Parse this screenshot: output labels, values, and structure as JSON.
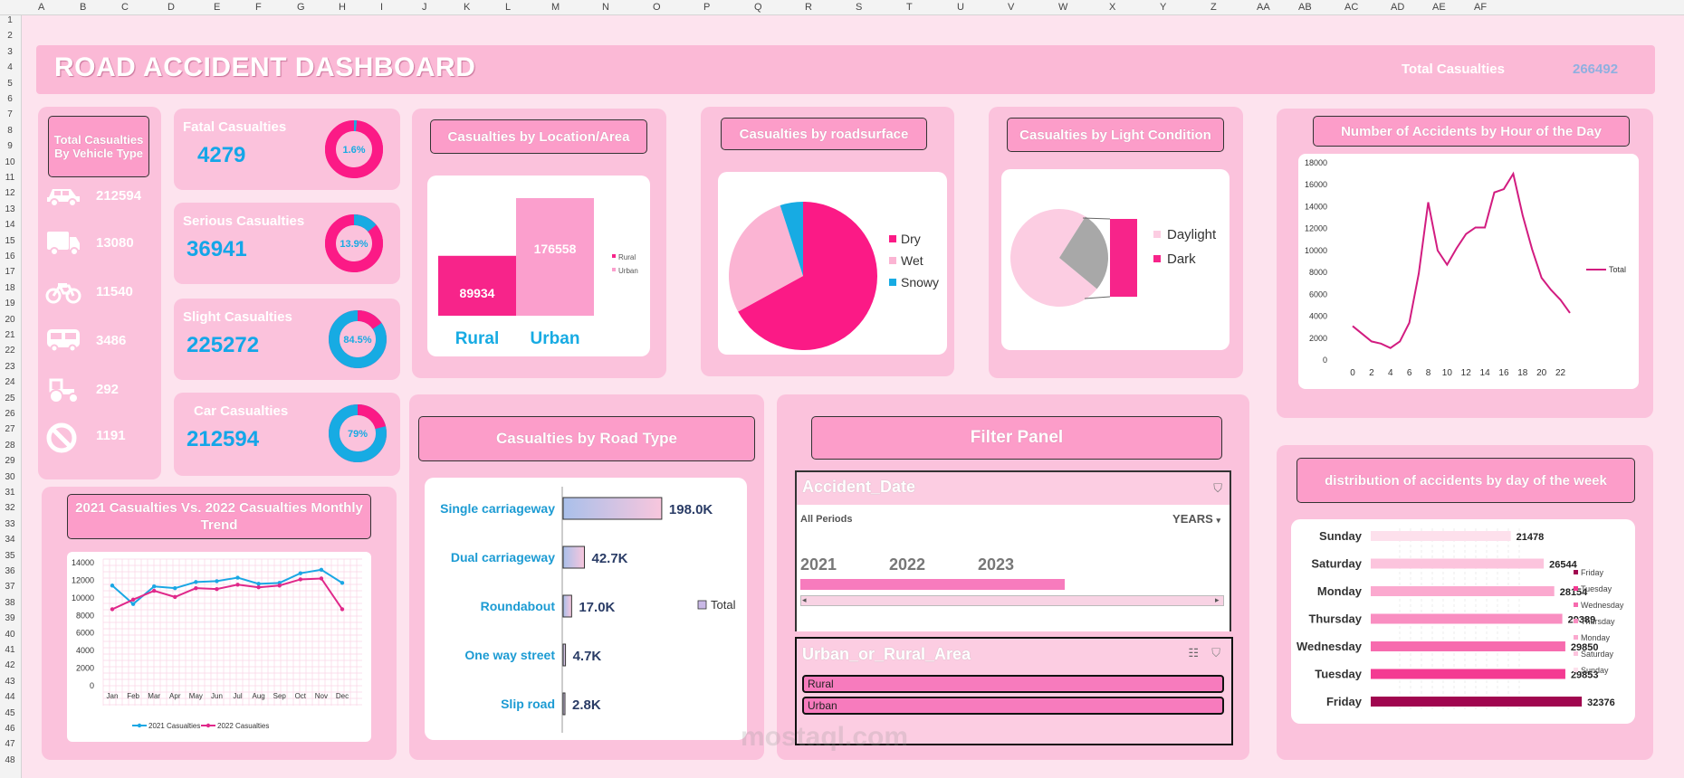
{
  "sheet": {
    "columns": [
      "A",
      "B",
      "C",
      "D",
      "E",
      "F",
      "G",
      "H",
      "I",
      "J",
      "K",
      "L",
      "M",
      "N",
      "O",
      "P",
      "Q",
      "R",
      "S",
      "T",
      "U",
      "V",
      "W",
      "X",
      "Y",
      "Z",
      "AA",
      "AB",
      "AC",
      "AD",
      "AE",
      "AF"
    ],
    "rows": [
      "1",
      "2",
      "3",
      "4",
      "5",
      "6",
      "7",
      "8",
      "9",
      "10",
      "11",
      "12",
      "13",
      "14",
      "15",
      "16",
      "17",
      "18",
      "19",
      "20",
      "21",
      "22",
      "23",
      "24",
      "25",
      "26",
      "27",
      "28",
      "29",
      "30",
      "31",
      "32",
      "33",
      "34",
      "35",
      "36",
      "37",
      "38",
      "39",
      "40",
      "41",
      "42",
      "43",
      "44",
      "45",
      "46",
      "47",
      "48"
    ]
  },
  "header": {
    "title": "ROAD ACCIDENT DASHBOARD",
    "total_label": "Total Casualties",
    "total_value": "266492"
  },
  "vehicle_type": {
    "title": "Total Casualties By Vehicle Type",
    "items": [
      {
        "icon": "car-icon",
        "value": "212594"
      },
      {
        "icon": "truck-icon",
        "value": "13080"
      },
      {
        "icon": "motorcycle-icon",
        "value": "11540"
      },
      {
        "icon": "bus-icon",
        "value": "3486"
      },
      {
        "icon": "tractor-icon",
        "value": "292"
      },
      {
        "icon": "no-entry-icon",
        "value": "1191"
      }
    ]
  },
  "kpis": [
    {
      "label": "Fatal Casualties",
      "value": "4279",
      "pct_label": "1.6%",
      "pct": 0.016
    },
    {
      "label": "Serious Casualties",
      "value": "36941",
      "pct_label": "13.9%",
      "pct": 0.139
    },
    {
      "label": "Slight Casualties",
      "value": "225272",
      "pct_label": "84.5%",
      "pct": 0.845
    },
    {
      "label": "Car Casualties",
      "value": "212594",
      "pct_label": "79%",
      "pct": 0.79
    }
  ],
  "location": {
    "title": "Casualties by Location/Area",
    "chart_data": {
      "type": "bar",
      "categories": [
        "Rural",
        "Urban"
      ],
      "values": [
        89934,
        176558
      ],
      "value_labels": [
        "89934",
        "176558"
      ],
      "legend": [
        "Rural",
        "Urban"
      ],
      "colors": [
        "#f7248a",
        "#fb9fcd"
      ]
    }
  },
  "surface": {
    "title": "Casualties by roadsurface",
    "chart_data": {
      "type": "pie",
      "categories": [
        "Dry",
        "Wet",
        "Snowy"
      ],
      "values": [
        67,
        28,
        5
      ],
      "colors": [
        "#fb1a86",
        "#fbb4d3",
        "#17abe3"
      ]
    }
  },
  "light": {
    "title": "Casualties by Light Condition",
    "chart_data": {
      "type": "pie",
      "categories": [
        "Daylight",
        "Dark"
      ],
      "values": [
        73,
        27
      ],
      "colors": [
        "#fccde2",
        "#f7248a"
      ]
    }
  },
  "hourly": {
    "title": "Number of Accidents by Hour of the Day",
    "chart_data": {
      "type": "line",
      "x": [
        0,
        1,
        2,
        3,
        4,
        5,
        6,
        7,
        8,
        9,
        10,
        11,
        12,
        13,
        14,
        15,
        16,
        17,
        18,
        19,
        20,
        21,
        22,
        23
      ],
      "series": [
        {
          "name": "Total",
          "values": [
            3100,
            2400,
            1700,
            1500,
            1100,
            1700,
            3400,
            7900,
            14400,
            10000,
            8700,
            10200,
            11500,
            12100,
            12100,
            15300,
            15600,
            17000,
            13200,
            10100,
            7500,
            6400,
            5500,
            4300
          ]
        }
      ],
      "x_ticks": [
        "0",
        "2",
        "4",
        "6",
        "8",
        "10",
        "12",
        "14",
        "16",
        "18",
        "20",
        "22"
      ],
      "y_ticks": [
        "0",
        "2000",
        "4000",
        "6000",
        "8000",
        "10000",
        "12000",
        "14000",
        "16000",
        "18000"
      ],
      "ylim": [
        0,
        18000
      ],
      "legend": "right",
      "color": "#d21c80"
    }
  },
  "monthly": {
    "title": "2021 Casualties Vs. 2022 Casualties Monthly Trend",
    "chart_data": {
      "type": "line",
      "categories": [
        "Jan",
        "Feb",
        "Mar",
        "Apr",
        "May",
        "Jun",
        "Jul",
        "Aug",
        "Sep",
        "Oct",
        "Nov",
        "Dec"
      ],
      "series": [
        {
          "name": "2021 Casualties",
          "values": [
            11400,
            9300,
            11300,
            11100,
            11800,
            11900,
            12300,
            11600,
            11700,
            12800,
            13200,
            11700
          ],
          "color": "#1aa7e4"
        },
        {
          "name": "2022 Casualties",
          "values": [
            8700,
            9800,
            10800,
            10100,
            11100,
            11000,
            11500,
            11200,
            11400,
            12100,
            12200,
            8700
          ],
          "color": "#e0288a"
        }
      ],
      "y_ticks": [
        "0",
        "2000",
        "4000",
        "6000",
        "8000",
        "10000",
        "12000",
        "14000"
      ],
      "ylim": [
        0,
        14000
      ],
      "legend": "bottom"
    }
  },
  "road_type": {
    "title": "Casualties by Road Type",
    "legend": "Total",
    "chart_data": {
      "type": "bar",
      "categories": [
        "Single carriageway",
        "Dual carriageway",
        "Roundabout",
        "One way street",
        "Slip road"
      ],
      "values": [
        198.0,
        42.7,
        17.0,
        4.7,
        2.8
      ],
      "value_labels": [
        "198.0K",
        "42.7K",
        "17.0K",
        "4.7K",
        "2.8K"
      ],
      "unit": "K"
    }
  },
  "filter": {
    "title": "Filter Panel",
    "date_slicer": {
      "title": "Accident_Date",
      "periods": "All Periods",
      "level": "YEARS",
      "years": [
        "2021",
        "2022",
        "2023"
      ]
    },
    "area_slicer": {
      "title": "Urban_or_Rural_Area",
      "items": [
        "Rural",
        "Urban"
      ]
    }
  },
  "weekday": {
    "title": "distribution of accidents by day of the week",
    "chart_data": {
      "type": "bar",
      "categories": [
        "Sunday",
        "Saturday",
        "Monday",
        "Thursday",
        "Wednesday",
        "Tuesday",
        "Friday"
      ],
      "values": [
        21478,
        26544,
        28154,
        29389,
        29850,
        29853,
        32376
      ],
      "value_labels": [
        "21478",
        "26544",
        "28154",
        "29389",
        "29850",
        "29853",
        "32376"
      ],
      "colors": [
        "#fde0ec",
        "#fcc4dd",
        "#fba9cf",
        "#f98ec1",
        "#f76bae",
        "#f43a92",
        "#a0064f"
      ],
      "legend": [
        "Friday",
        "Tuesday",
        "Wednesday",
        "Thursday",
        "Monday",
        "Saturday",
        "Sunday"
      ],
      "xlim": [
        0,
        35000
      ]
    }
  },
  "watermark": "mostaql.com"
}
